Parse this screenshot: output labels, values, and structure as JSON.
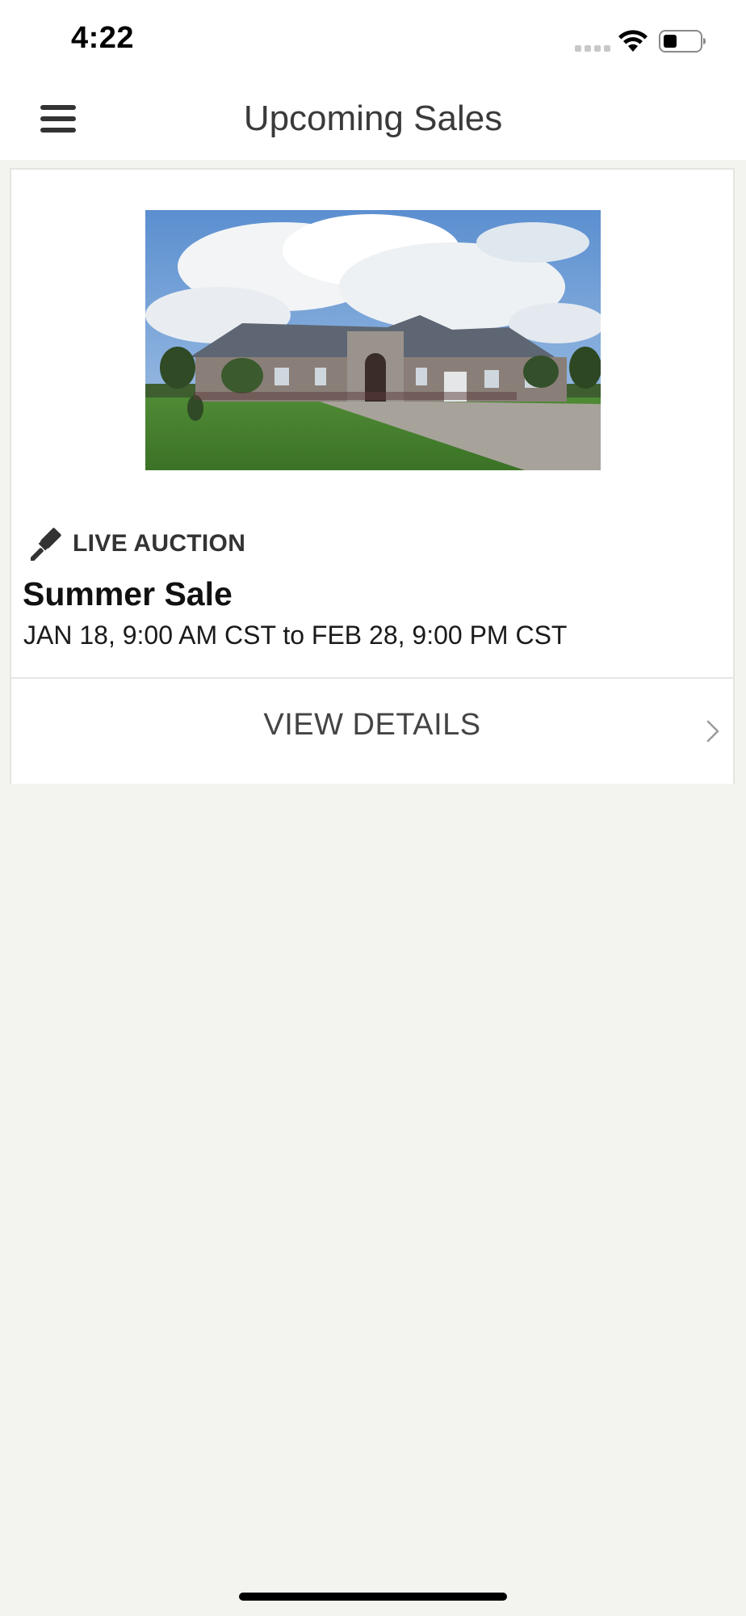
{
  "status_bar": {
    "time": "4:22"
  },
  "nav": {
    "title": "Upcoming Sales",
    "menu_icon": "hamburger-menu-icon"
  },
  "sale": {
    "auction_type": "LIVE AUCTION",
    "auction_type_icon": "gavel-icon",
    "title": "Summer Sale",
    "dates": "JAN 18, 9:00 AM CST to FEB 28, 9:00 PM CST",
    "view_details_label": "VIEW DETAILS",
    "view_details_icon": "chevron-right-icon"
  },
  "colors": {
    "background": "#f3f3f0",
    "card": "#ffffff",
    "text_primary": "#111111",
    "text_secondary": "#444444"
  }
}
